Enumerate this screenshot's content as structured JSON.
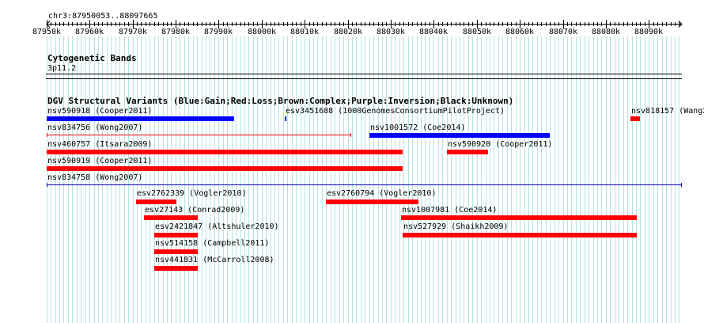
{
  "region": {
    "label": "chr3:87950053..88097665",
    "start": 87950053,
    "end": 88097665
  },
  "ruler": {
    "ticks": [
      "87950k",
      "87960k",
      "87970k",
      "87980k",
      "87990k",
      "88000k",
      "88010k",
      "88020k",
      "88030k",
      "88040k",
      "88050k",
      "88060k",
      "88070k",
      "88080k",
      "88090k"
    ],
    "tick_values": [
      87950000,
      87960000,
      87970000,
      87980000,
      87990000,
      88000000,
      88010000,
      88020000,
      88030000,
      88040000,
      88050000,
      88060000,
      88070000,
      88080000,
      88090000
    ]
  },
  "cytoband_track": {
    "title": "Cytogenetic Bands",
    "band": "3p11.2"
  },
  "dgv_track": {
    "title": "DGV Structural Variants (Blue:Gain;Red:Loss;Brown:Complex;Purple:Inversion;Black:Unknown)",
    "colors": {
      "gain": "#0000ff",
      "loss": "#ff0000",
      "unknown": "#0000b0"
    },
    "features": [
      {
        "id": "nsv590918",
        "label": "nsv590918 (Cooper2011)",
        "type": "gain",
        "style": "bar",
        "start": 87950053,
        "end": 87993700
      },
      {
        "id": "esv3451688",
        "label": "esv3451688 (1000GenomesConsortiumPilotProject)",
        "type": "gain",
        "style": "bar",
        "start": 88005400,
        "end": 88005700
      },
      {
        "id": "nsv818157",
        "label": "nsv818157 (Wang2008)",
        "type": "loss",
        "style": "bar",
        "start": 88085700,
        "end": 88088000
      },
      {
        "id": "nsv834756",
        "label": "nsv834756 (Wong2007)",
        "type": "loss",
        "style": "line",
        "start": 87950053,
        "end": 88020900
      },
      {
        "id": "nsv1001572",
        "label": "nsv1001572 (Coe2014)",
        "type": "gain",
        "style": "bar",
        "start": 88025000,
        "end": 88067000
      },
      {
        "id": "nsv460757",
        "label": "nsv460757 (Itsara2009)",
        "type": "loss",
        "style": "bar",
        "start": 87950053,
        "end": 88032700
      },
      {
        "id": "nsv590920",
        "label": "nsv590920 (Cooper2011)",
        "type": "loss",
        "style": "bar",
        "start": 88043000,
        "end": 88052600
      },
      {
        "id": "nsv590919",
        "label": "nsv590919 (Cooper2011)",
        "type": "loss",
        "style": "bar",
        "start": 87950053,
        "end": 88032700
      },
      {
        "id": "nsv834758",
        "label": "nsv834758 (Wong2007)",
        "type": "unknown",
        "style": "line",
        "start": 87950053,
        "end": 88097665
      },
      {
        "id": "esv2762339",
        "label": "esv2762339 (Vogler2010)",
        "type": "loss",
        "style": "bar",
        "start": 87970900,
        "end": 87980200
      },
      {
        "id": "esv2760794",
        "label": "esv2760794 (Vogler2010)",
        "type": "loss",
        "style": "bar",
        "start": 88015000,
        "end": 88036500
      },
      {
        "id": "esv27143",
        "label": "esv27143 (Conrad2009)",
        "type": "loss",
        "style": "bar",
        "start": 87972600,
        "end": 87985200
      },
      {
        "id": "nsv1007981",
        "label": "nsv1007981 (Coe2014)",
        "type": "loss",
        "style": "bar",
        "start": 88032400,
        "end": 88087200
      },
      {
        "id": "esv2421847",
        "label": "esv2421847 (Altshuler2010)",
        "type": "loss",
        "style": "bar",
        "start": 87975000,
        "end": 87985200
      },
      {
        "id": "nsv527929",
        "label": "nsv527929 (Shaikh2009)",
        "type": "loss",
        "style": "bar",
        "start": 88032700,
        "end": 88087200
      },
      {
        "id": "nsv514158",
        "label": "nsv514158 (Campbell2011)",
        "type": "loss",
        "style": "bar",
        "start": 87975000,
        "end": 87985200
      },
      {
        "id": "nsv441831",
        "label": "nsv441831 (McCarroll2008)",
        "type": "loss",
        "style": "bar",
        "start": 87975000,
        "end": 87985200
      }
    ]
  }
}
